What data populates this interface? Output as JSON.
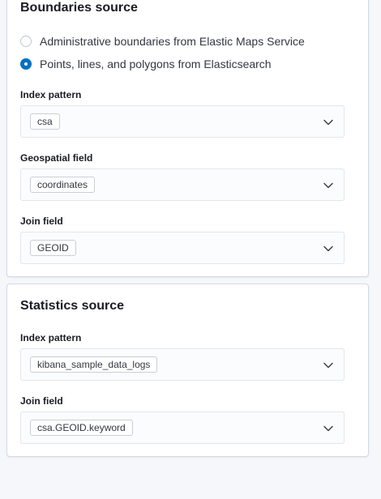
{
  "boundaries": {
    "title": "Boundaries source",
    "options": [
      {
        "label": "Administrative boundaries from Elastic Maps Service",
        "checked": false
      },
      {
        "label": "Points, lines, and polygons from Elasticsearch",
        "checked": true
      }
    ],
    "index_pattern": {
      "label": "Index pattern",
      "value": "csa"
    },
    "geospatial_field": {
      "label": "Geospatial field",
      "value": "coordinates"
    },
    "join_field": {
      "label": "Join field",
      "value": "GEOID"
    }
  },
  "statistics": {
    "title": "Statistics source",
    "index_pattern": {
      "label": "Index pattern",
      "value": "kibana_sample_data_logs"
    },
    "join_field": {
      "label": "Join field",
      "value": "csa.GEOID.keyword"
    }
  },
  "colors": {
    "accent": "#0071c2",
    "border": "#d3dae6",
    "background": "#f5f7fa"
  },
  "icons": {
    "dropdown": "chevron-down-icon"
  }
}
